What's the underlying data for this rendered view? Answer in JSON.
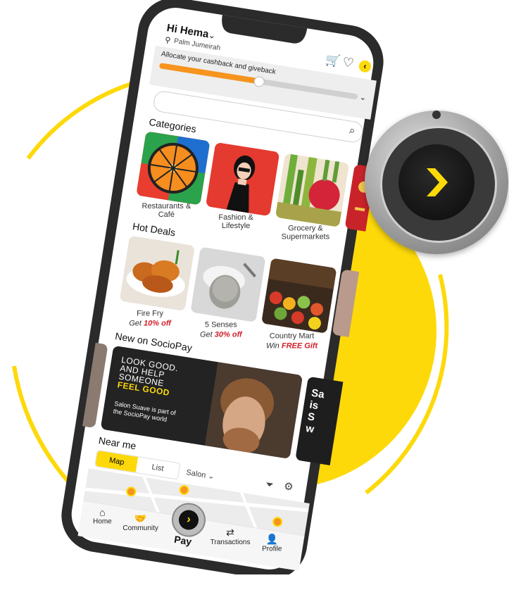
{
  "header": {
    "greeting": "Hi Hema",
    "location": "Palm Jumeirah"
  },
  "cashback": {
    "label": "Allocate your cashback and giveback",
    "progress": 0.5
  },
  "search": {
    "placeholder": ""
  },
  "categories": {
    "title": "Categories",
    "items": [
      {
        "label_line1": "Restaurants &",
        "label_line2": "Café"
      },
      {
        "label_line1": "Fashion &",
        "label_line2": "Lifestyle"
      },
      {
        "label_line1": "Grocery &",
        "label_line2": "Supermarkets"
      }
    ]
  },
  "hot_deals": {
    "title": "Hot Deals",
    "items": [
      {
        "name": "Fire Fry",
        "prefix": "Get",
        "offer": "10% off"
      },
      {
        "name": "5 Senses",
        "prefix": "Get",
        "offer": "30% off"
      },
      {
        "name": "Country Mart",
        "prefix": "Win",
        "offer": "FREE Gift"
      }
    ]
  },
  "new_on": {
    "title": "New on SocioPay",
    "banner": {
      "line1": "LOOK GOOD.",
      "line2": "AND HELP",
      "line3": "SOMEONE",
      "line4": "FEEL GOOD",
      "sub1": "Salon Suave is part of",
      "sub2": "the SocioPay world"
    },
    "peek_text": [
      "Sa",
      "is",
      "S",
      "w"
    ]
  },
  "near_me": {
    "title": "Near me",
    "tabs": [
      "Map",
      "List"
    ],
    "filter": "Salon"
  },
  "bottom_nav": {
    "items": [
      "Home",
      "Community",
      "Pay",
      "Transactions",
      "Profile"
    ]
  },
  "colors": {
    "accent": "#f7941d",
    "yellow": "#ffd400",
    "dark": "#2a2a2a",
    "offer_red": "#d0202a"
  }
}
